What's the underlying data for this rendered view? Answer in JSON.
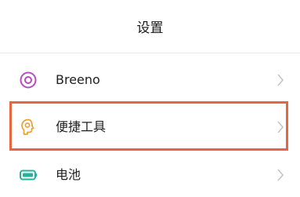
{
  "header": {
    "title": "设置"
  },
  "items": [
    {
      "label": "Breeno",
      "icon": "breeno-icon",
      "icon_color": "#b54cbf"
    },
    {
      "label": "便捷工具",
      "icon": "convenience-tools-icon",
      "icon_color": "#e8a23a"
    },
    {
      "label": "电池",
      "icon": "battery-icon",
      "icon_color": "#23b39b"
    }
  ],
  "highlight": {
    "color": "#e6673e",
    "target": "便捷工具"
  }
}
